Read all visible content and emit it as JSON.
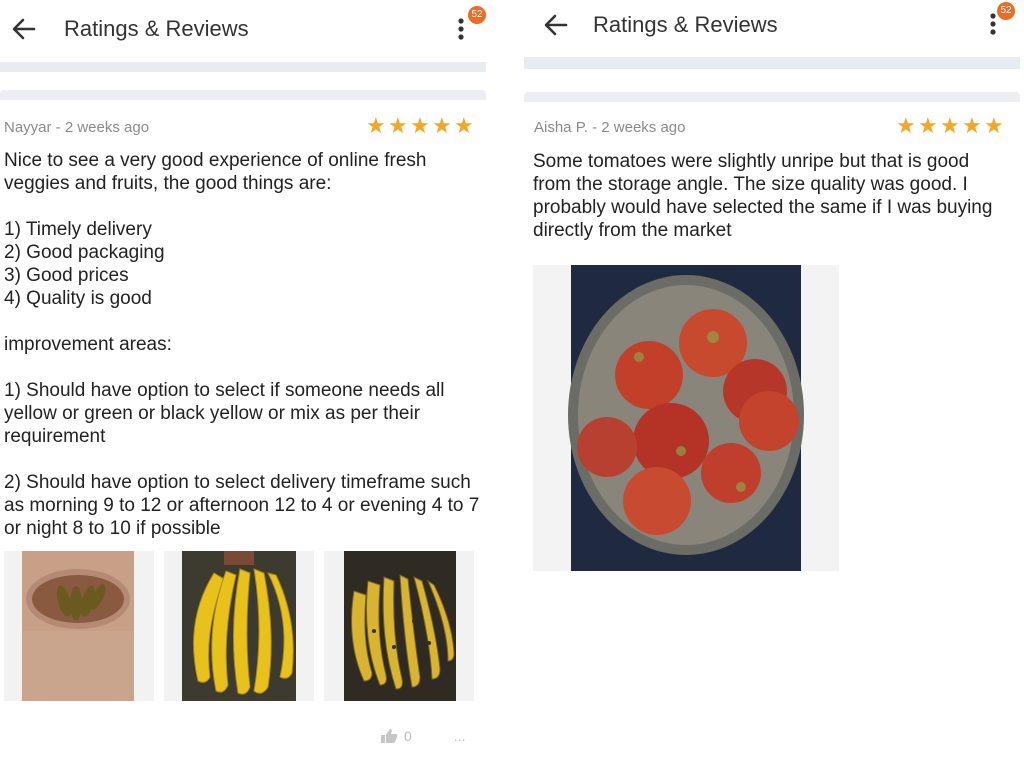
{
  "left": {
    "header": {
      "title": "Ratings & Reviews",
      "badge": "52"
    },
    "review": {
      "author_line": "Nayyar - 2  weeks ago",
      "rating": 5,
      "text": "Nice to see a very good experience of online fresh veggies and fruits, the good things are:\n\n1) Timely delivery\n2) Good packaging\n3) Good prices\n4) Quality is good\n\nimprovement areas:\n\n1) Should have option to select if someone needs all yellow or green or black yellow or mix as per their requirement\n\n2) Should have option to select delivery timeframe such as morning 9 to 12 or afternoon 12 to 4 or evening 4 to 7 or night 8 to 10 if possible",
      "photos": [
        "banana-bunch-in-bag",
        "banana-bunch-yellow",
        "banana-bunch-ripe"
      ],
      "like_count": "0",
      "more": "..."
    }
  },
  "right": {
    "header": {
      "title": "Ratings & Reviews",
      "badge": "52"
    },
    "review": {
      "author_line": "Aisha P. - 2  weeks ago",
      "rating": 5,
      "text": "Some tomatoes were slightly unripe but that is good from the storage angle. The size quality was good. I probably would have selected the same if I was buying directly from the market",
      "photos": [
        "tomatoes-in-steel-bowl"
      ]
    }
  },
  "colors": {
    "star": "#f5a623",
    "badge": "#f26a21",
    "strip": "#e8ebf1"
  },
  "icons": {
    "back": "arrow-left-icon",
    "menu": "kebab-menu-icon",
    "like": "thumbs-up-icon",
    "star": "star-icon"
  }
}
